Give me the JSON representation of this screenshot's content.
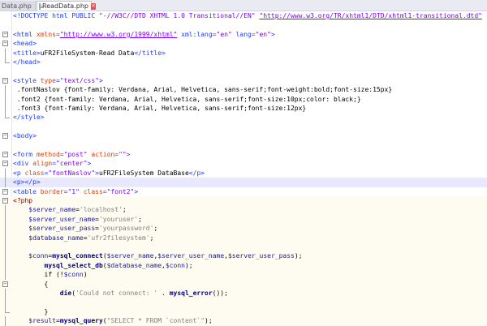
{
  "tabs": [
    {
      "label": "Data.php",
      "active": false,
      "close": "×"
    },
    {
      "label": "ReadData.php",
      "active": true,
      "close": "×"
    }
  ],
  "colors": {
    "tag": "#1f3cff",
    "attribute": "#e33c00",
    "string": "#8000ff",
    "php_background": "#fefcf0",
    "current_line": "#e8e8ff"
  },
  "lines": [
    {
      "fold": "",
      "bg": "",
      "tokens": [
        [
          "tag",
          "<!DOCTYPE html PUBLIC "
        ],
        [
          "str",
          "\"-//W3C//DTD XHTML 1.0 Transitional//EN\""
        ],
        [
          "tag",
          " "
        ],
        [
          "str",
          "\"http://www.w3.org/TR/xhtml1/DTD/xhtml1-transitional.dtd\""
        ]
      ]
    },
    {
      "fold": "",
      "bg": "",
      "tokens": []
    },
    {
      "fold": "box",
      "bg": "",
      "tokens": [
        [
          "tag",
          "<html "
        ],
        [
          "attr",
          "xmlns"
        ],
        [
          "tag",
          "="
        ],
        [
          "str",
          "\"http://www.w3.org/1999/xhtml\""
        ],
        [
          "tag",
          " xml:lang="
        ],
        [
          "str",
          "\"en\""
        ],
        [
          "tag",
          " lang="
        ],
        [
          "str",
          "\"en\""
        ],
        [
          "tag",
          ">"
        ]
      ]
    },
    {
      "fold": "box",
      "bg": "",
      "tokens": [
        [
          "tag",
          "<head>"
        ]
      ]
    },
    {
      "fold": "line",
      "bg": "",
      "tokens": [
        [
          "tag",
          "<title>"
        ],
        [
          "txt",
          "uFR2FileSystem-Read Data"
        ],
        [
          "tag",
          "</title>"
        ]
      ]
    },
    {
      "fold": "end",
      "bg": "",
      "tokens": [
        [
          "tag",
          "</head>"
        ]
      ]
    },
    {
      "fold": "",
      "bg": "",
      "tokens": []
    },
    {
      "fold": "box",
      "bg": "",
      "tokens": [
        [
          "tag",
          "<style "
        ],
        [
          "attr",
          "type"
        ],
        [
          "tag",
          "="
        ],
        [
          "str",
          "\"text/css\""
        ],
        [
          "tag",
          ">"
        ]
      ]
    },
    {
      "fold": "line",
      "bg": "",
      "tokens": [
        [
          "css",
          " .fontNaslov {font-family: Verdana, Arial, Helvetica, sans-serif;font-weight:bold;font-size:15px}"
        ]
      ]
    },
    {
      "fold": "line",
      "bg": "",
      "tokens": [
        [
          "css",
          " .font2 {font-family: Verdana, Arial, Helvetica, sans-serif;font-size:10px;color: black;}"
        ]
      ]
    },
    {
      "fold": "line",
      "bg": "",
      "tokens": [
        [
          "css",
          " .font3 {font-family: Verdana, Arial, Helvetica, sans-serif;font-size:12px}"
        ]
      ]
    },
    {
      "fold": "end",
      "bg": "",
      "tokens": [
        [
          "tag",
          "</style>"
        ]
      ]
    },
    {
      "fold": "",
      "bg": "",
      "tokens": []
    },
    {
      "fold": "box",
      "bg": "",
      "tokens": [
        [
          "tag",
          "<body>"
        ]
      ]
    },
    {
      "fold": "",
      "bg": "",
      "tokens": []
    },
    {
      "fold": "box",
      "bg": "",
      "tokens": [
        [
          "tag",
          "<form "
        ],
        [
          "attr",
          "method"
        ],
        [
          "tag",
          "="
        ],
        [
          "str",
          "\"post\""
        ],
        [
          "tag",
          " "
        ],
        [
          "attr",
          "action"
        ],
        [
          "tag",
          "="
        ],
        [
          "str",
          "\"\""
        ],
        [
          "tag",
          ">"
        ]
      ]
    },
    {
      "fold": "box",
      "bg": "",
      "tokens": [
        [
          "tag",
          "<div "
        ],
        [
          "attr",
          "align"
        ],
        [
          "tag",
          "="
        ],
        [
          "str",
          "\"center\""
        ],
        [
          "tag",
          ">"
        ]
      ]
    },
    {
      "fold": "line",
      "bg": "",
      "tokens": [
        [
          "tag",
          "<p "
        ],
        [
          "attr",
          "class"
        ],
        [
          "tag",
          "="
        ],
        [
          "str",
          "\"fontNaslov\""
        ],
        [
          "tag",
          ">"
        ],
        [
          "txt",
          "uFR2FileSystem DataBase"
        ],
        [
          "tag",
          "</p>"
        ]
      ]
    },
    {
      "fold": "line",
      "bg": "current",
      "tokens": [
        [
          "tag",
          "<p></p>"
        ]
      ]
    },
    {
      "fold": "box",
      "bg": "",
      "tokens": [
        [
          "tag",
          "<table "
        ],
        [
          "attr",
          "border"
        ],
        [
          "tag",
          "="
        ],
        [
          "str",
          "\"1\""
        ],
        [
          "tag",
          " "
        ],
        [
          "attr",
          "class"
        ],
        [
          "tag",
          "="
        ],
        [
          "str",
          "\"font2\""
        ],
        [
          "tag",
          ">"
        ]
      ]
    },
    {
      "fold": "box",
      "bg": "php",
      "tokens": [
        [
          "op",
          "<?php"
        ]
      ]
    },
    {
      "fold": "line",
      "bg": "php",
      "tokens": [
        [
          "php",
          "    "
        ],
        [
          "var",
          "$server_name"
        ],
        [
          "php",
          "="
        ],
        [
          "phpstr",
          "'localhost'"
        ],
        [
          "php",
          ";"
        ]
      ]
    },
    {
      "fold": "line",
      "bg": "php",
      "tokens": [
        [
          "php",
          "    "
        ],
        [
          "var",
          "$server_user_name"
        ],
        [
          "php",
          "="
        ],
        [
          "phpstr",
          "'youruser'"
        ],
        [
          "php",
          ";"
        ]
      ]
    },
    {
      "fold": "line",
      "bg": "php",
      "tokens": [
        [
          "php",
          "    "
        ],
        [
          "var",
          "$server_user_pass"
        ],
        [
          "php",
          "="
        ],
        [
          "phpstr",
          "'yourpassword'"
        ],
        [
          "php",
          ";"
        ]
      ]
    },
    {
      "fold": "line",
      "bg": "php",
      "tokens": [
        [
          "php",
          "    "
        ],
        [
          "var",
          "$database_name"
        ],
        [
          "php",
          "="
        ],
        [
          "phpstr",
          "'ufr2filesystem'"
        ],
        [
          "php",
          ";"
        ]
      ]
    },
    {
      "fold": "line",
      "bg": "php",
      "tokens": []
    },
    {
      "fold": "line",
      "bg": "php",
      "tokens": [
        [
          "php",
          "    "
        ],
        [
          "var",
          "$conn"
        ],
        [
          "php",
          "="
        ],
        [
          "fn",
          "mysql_connect"
        ],
        [
          "php",
          "("
        ],
        [
          "var",
          "$server_name"
        ],
        [
          "php",
          ","
        ],
        [
          "var",
          "$server_user_name"
        ],
        [
          "php",
          ","
        ],
        [
          "var",
          "$server_user_pass"
        ],
        [
          "php",
          ");"
        ]
      ]
    },
    {
      "fold": "line",
      "bg": "php",
      "tokens": [
        [
          "php",
          "        "
        ],
        [
          "fn",
          "mysql_select_db"
        ],
        [
          "php",
          "("
        ],
        [
          "var",
          "$database_name"
        ],
        [
          "php",
          ","
        ],
        [
          "var",
          "$conn"
        ],
        [
          "php",
          ");"
        ]
      ]
    },
    {
      "fold": "line",
      "bg": "php",
      "tokens": [
        [
          "php",
          "        if (!"
        ],
        [
          "var",
          "$conn"
        ],
        [
          "php",
          ")"
        ]
      ]
    },
    {
      "fold": "box",
      "bg": "php",
      "tokens": [
        [
          "php",
          "        {"
        ]
      ]
    },
    {
      "fold": "line",
      "bg": "php",
      "tokens": [
        [
          "php",
          "            "
        ],
        [
          "fn",
          "die"
        ],
        [
          "php",
          "("
        ],
        [
          "phpstr",
          "'Could not connect: '"
        ],
        [
          "php",
          " . "
        ],
        [
          "fn",
          "mysql_error"
        ],
        [
          "php",
          "());"
        ]
      ]
    },
    {
      "fold": "line",
      "bg": "php",
      "tokens": []
    },
    {
      "fold": "end",
      "bg": "php",
      "tokens": [
        [
          "php",
          "        }"
        ]
      ]
    },
    {
      "fold": "line",
      "bg": "php",
      "tokens": [
        [
          "php",
          "    "
        ],
        [
          "var",
          "$result"
        ],
        [
          "php",
          "="
        ],
        [
          "fn",
          "mysql_query"
        ],
        [
          "php",
          "("
        ],
        [
          "phpstr",
          "\"SELECT * FROM `content`\""
        ],
        [
          "php",
          ");"
        ]
      ]
    }
  ]
}
